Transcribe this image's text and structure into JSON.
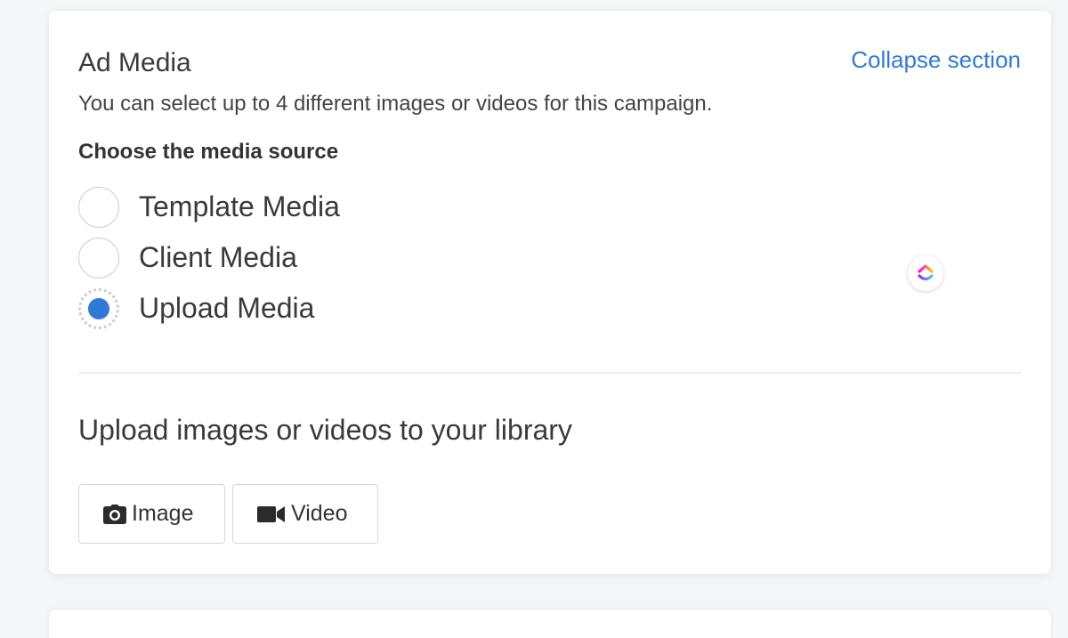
{
  "ad_media": {
    "title": "Ad Media",
    "collapse_label": "Collapse section",
    "description": "You can select up to 4 different images or videos for this campaign.",
    "source_label": "Choose the media source",
    "options": [
      {
        "label": "Template Media",
        "selected": false
      },
      {
        "label": "Client Media",
        "selected": false
      },
      {
        "label": "Upload Media",
        "selected": true
      }
    ]
  },
  "upload": {
    "title": "Upload images or videos to your library",
    "image_button": "Image",
    "video_button": "Video"
  },
  "icons": {
    "image_button_icon": "camera-icon",
    "video_button_icon": "video-camera-icon",
    "floating_badge_icon": "clickup-logo-icon"
  },
  "colors": {
    "accent": "#2f7ad8",
    "text": "#3a3a3a",
    "border": "#d6d6d6"
  }
}
